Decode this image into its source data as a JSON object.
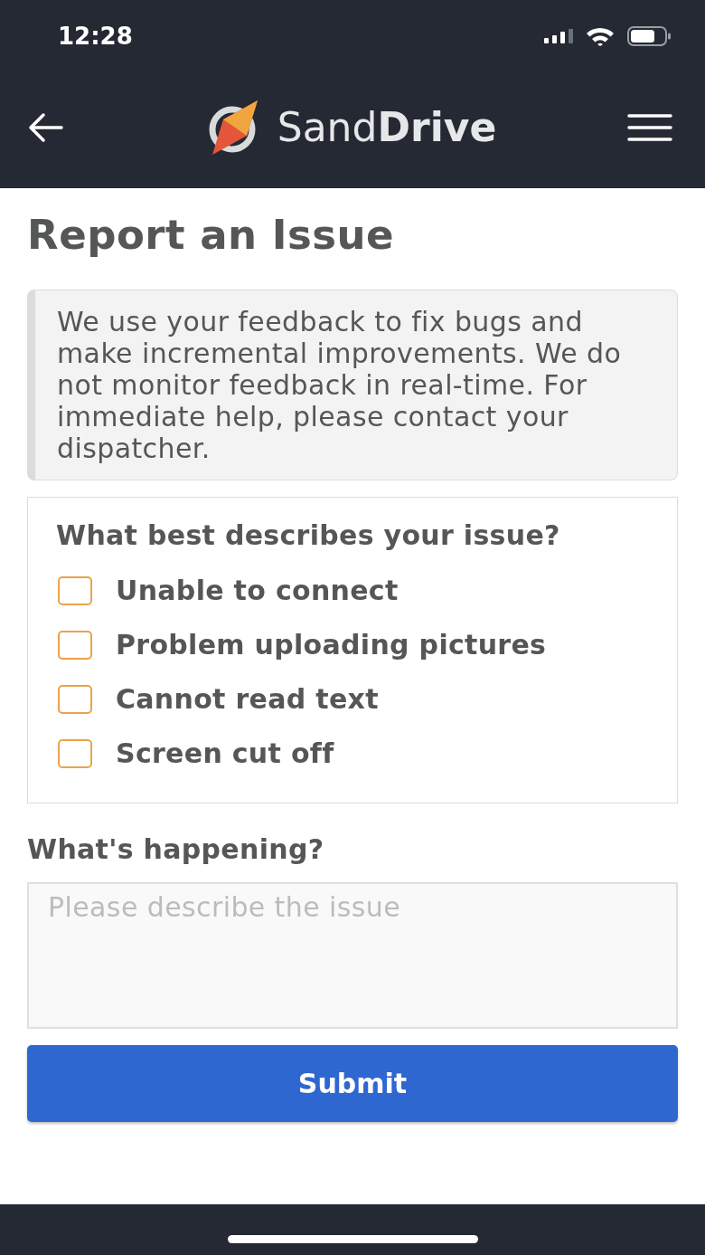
{
  "status_bar": {
    "time": "12:28"
  },
  "header": {
    "app_name": "Sand**Drive**"
  },
  "page": {
    "title": "Report an Issue",
    "notice": "We use your feedback to fix bugs and make incremental improvements. We do not monitor feedback in real-time. For immediate help, please contact your dispatcher.",
    "issue_group": {
      "question": "What best describes your issue?",
      "options": [
        {
          "label": "Unable to connect",
          "checked": false
        },
        {
          "label": "Problem uploading pictures",
          "checked": false
        },
        {
          "label": "Cannot read text",
          "checked": false
        },
        {
          "label": "Screen cut off",
          "checked": false
        }
      ]
    },
    "details": {
      "label": "What's happening?",
      "placeholder": "Please describe the issue"
    },
    "submit": "Submit"
  }
}
